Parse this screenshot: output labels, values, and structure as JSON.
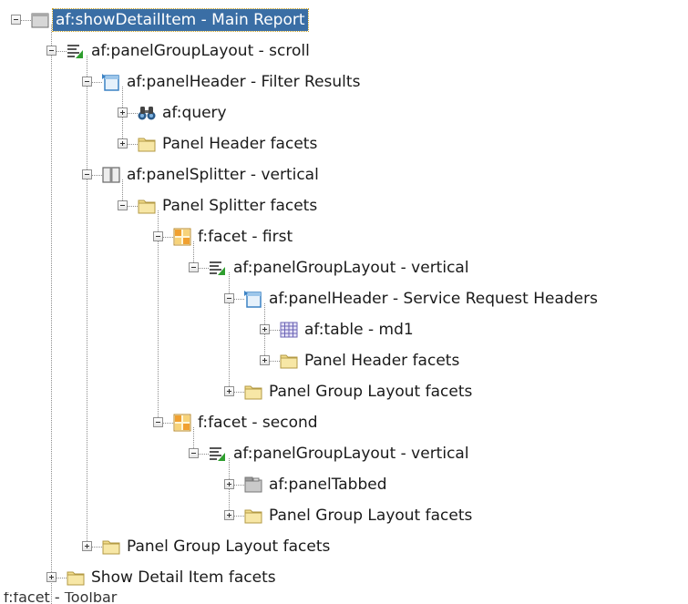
{
  "tree": {
    "nodes": [
      {
        "label": "af:showDetailItem - Main Report",
        "icon": "show-detail-item-icon",
        "toggle": "minus",
        "depth": 0,
        "selected": true
      },
      {
        "label": "af:panelGroupLayout - scroll",
        "icon": "panel-group-layout-icon",
        "toggle": "minus",
        "depth": 1
      },
      {
        "label": "af:panelHeader - Filter Results",
        "icon": "panel-header-icon",
        "toggle": "minus",
        "depth": 2
      },
      {
        "label": "af:query",
        "icon": "binoculars-icon",
        "toggle": "plus",
        "depth": 3
      },
      {
        "label": "Panel Header facets",
        "icon": "folder-icon",
        "toggle": "plus",
        "depth": 3
      },
      {
        "label": "af:panelSplitter - vertical",
        "icon": "panel-splitter-icon",
        "toggle": "minus",
        "depth": 2
      },
      {
        "label": "Panel Splitter facets",
        "icon": "folder-icon",
        "toggle": "minus",
        "depth": 3
      },
      {
        "label": "f:facet - first",
        "icon": "facet-icon",
        "toggle": "minus",
        "depth": 4
      },
      {
        "label": "af:panelGroupLayout - vertical",
        "icon": "panel-group-layout-icon",
        "toggle": "minus",
        "depth": 5
      },
      {
        "label": "af:panelHeader - Service Request Headers",
        "icon": "panel-header-icon",
        "toggle": "minus",
        "depth": 6
      },
      {
        "label": "af:table - md1",
        "icon": "table-icon",
        "toggle": "plus",
        "depth": 7
      },
      {
        "label": "Panel Header facets",
        "icon": "folder-icon",
        "toggle": "plus",
        "depth": 7
      },
      {
        "label": "Panel Group Layout facets",
        "icon": "folder-icon",
        "toggle": "plus",
        "depth": 6
      },
      {
        "label": "f:facet - second",
        "icon": "facet-icon",
        "toggle": "minus",
        "depth": 4
      },
      {
        "label": "af:panelGroupLayout - vertical",
        "icon": "panel-group-layout-icon",
        "toggle": "minus",
        "depth": 5
      },
      {
        "label": "af:panelTabbed",
        "icon": "panel-tabbed-icon",
        "toggle": "plus",
        "depth": 6
      },
      {
        "label": "Panel Group Layout facets",
        "icon": "folder-icon",
        "toggle": "plus",
        "depth": 6
      },
      {
        "label": "Panel Group Layout facets",
        "icon": "folder-icon",
        "toggle": "plus",
        "depth": 2
      },
      {
        "label": "Show Detail Item facets",
        "icon": "folder-icon",
        "toggle": "plus",
        "depth": 1
      }
    ],
    "cut_off_text": "f:facet - Toolbar"
  },
  "colors": {
    "selection": "#3a6ea5",
    "folder": "#f2dc8c",
    "facet_orange": "#f0a030",
    "layout_green": "#2e9e2e",
    "header_blue": "#3b82c4"
  }
}
